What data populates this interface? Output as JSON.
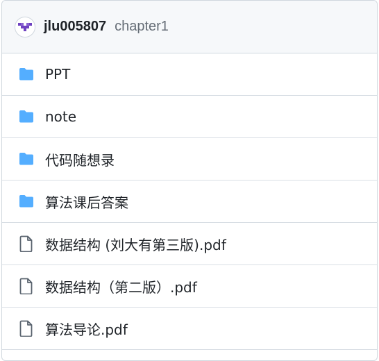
{
  "header": {
    "owner": "jlu005807",
    "path": "chapter1"
  },
  "colors": {
    "folder": "#54aeff",
    "file": "#59636e",
    "avatar": "#6f42c1"
  },
  "items": [
    {
      "type": "folder",
      "icon": "folder-icon",
      "label": "PPT"
    },
    {
      "type": "folder",
      "icon": "folder-icon",
      "label": "note"
    },
    {
      "type": "folder",
      "icon": "folder-icon",
      "label": "代码随想录"
    },
    {
      "type": "folder",
      "icon": "folder-icon",
      "label": "算法课后答案"
    },
    {
      "type": "file",
      "icon": "file-icon",
      "label": "数据结构 (刘大有第三版).pdf"
    },
    {
      "type": "file",
      "icon": "file-icon",
      "label": "数据结构（第二版）.pdf"
    },
    {
      "type": "file",
      "icon": "file-icon",
      "label": "算法导论.pdf"
    }
  ]
}
